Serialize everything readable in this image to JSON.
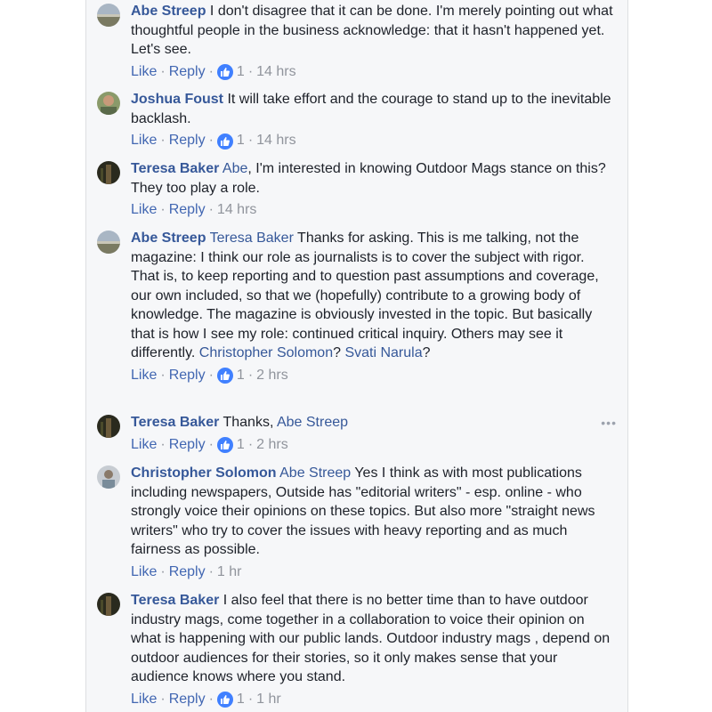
{
  "comments": [
    {
      "author": "Abe Streep",
      "mention": "",
      "text": "I don't disagree that it can be done. I'm merely pointing out what thoughtful people in the business acknowledge: that it hasn't happened yet. Let's see.",
      "like": "Like",
      "reply": "Reply",
      "likes": "1",
      "time": "14 hrs"
    },
    {
      "author": "Joshua Foust",
      "mention": "",
      "text": "It will take effort and the courage to stand up to the inevitable backlash.",
      "like": "Like",
      "reply": "Reply",
      "likes": "1",
      "time": "14 hrs"
    },
    {
      "author": "Teresa Baker",
      "mention": "Abe",
      "text": ", I'm interested in knowing Outdoor Mags stance on this? They too play a role.",
      "like": "Like",
      "reply": "Reply",
      "likes": "",
      "time": "14 hrs"
    },
    {
      "author": "Abe Streep",
      "mention": "Teresa Baker",
      "text": "Thanks for asking. This is me talking, not the magazine: I think our role as journalists is to cover the subject with rigor. That is, to keep reporting and to question past assumptions and coverage, our own included, so that we (hopefully) contribute to a growing body of knowledge. The magazine is obviously invested in the topic. But basically that is how I see my role: continued critical inquiry. Others may see it differently.",
      "mention2": "Christopher Solomon",
      "text2": "?",
      "mention3": "Svati Narula",
      "text3": "?",
      "like": "Like",
      "reply": "Reply",
      "likes": "1",
      "time": "2 hrs"
    },
    {
      "author": "Teresa Baker",
      "mention": "",
      "text": "Thanks,",
      "mention2": "Abe Streep",
      "like": "Like",
      "reply": "Reply",
      "likes": "1",
      "time": "2 hrs"
    },
    {
      "author": "Christopher Solomon",
      "mention": "Abe Streep",
      "text": "Yes I think as with most publications including newspapers, Outside has \"editorial writers\" - esp. online - who strongly voice their opinions on these topics. But also more \"straight news writers\" who try to cover the issues with heavy reporting and as much fairness as possible.",
      "like": "Like",
      "reply": "Reply",
      "likes": "",
      "time": "1 hr"
    },
    {
      "author": "Teresa Baker",
      "mention": "",
      "text": "I also feel that there is no better time than to have outdoor industry mags, come together in a collaboration to voice their opinion on what is happening with our public lands. Outdoor industry mags , depend on outdoor audiences for their stories, so it only makes sense that your audience knows where you stand.",
      "like": "Like",
      "reply": "Reply",
      "likes": "1",
      "time": "1 hr"
    }
  ],
  "more_label": "•••",
  "colors": {
    "link": "#365899",
    "action": "#4267b2",
    "meta": "#90949c",
    "like_badge": "#4080ff"
  }
}
